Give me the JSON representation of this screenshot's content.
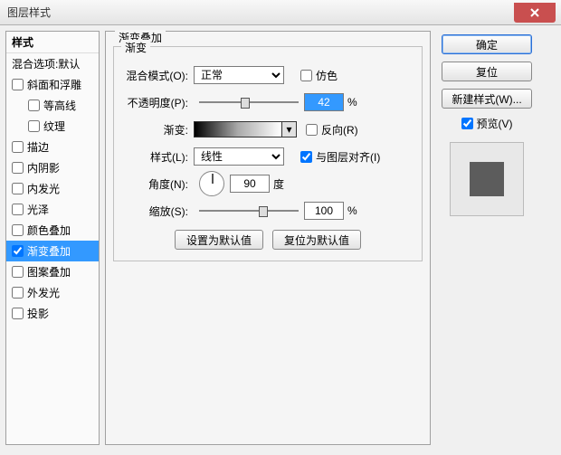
{
  "window": {
    "title": "图层样式"
  },
  "sidebar": {
    "header": "样式",
    "blend": "混合选项:默认",
    "items": [
      {
        "label": "斜面和浮雕",
        "checked": false
      },
      {
        "label": "等高线",
        "checked": false,
        "indent": true
      },
      {
        "label": "纹理",
        "checked": false,
        "indent": true
      },
      {
        "label": "描边",
        "checked": false
      },
      {
        "label": "内阴影",
        "checked": false
      },
      {
        "label": "内发光",
        "checked": false
      },
      {
        "label": "光泽",
        "checked": false
      },
      {
        "label": "颜色叠加",
        "checked": false
      },
      {
        "label": "渐变叠加",
        "checked": true,
        "selected": true
      },
      {
        "label": "图案叠加",
        "checked": false
      },
      {
        "label": "外发光",
        "checked": false
      },
      {
        "label": "投影",
        "checked": false
      }
    ]
  },
  "panel": {
    "title": "渐变叠加",
    "group": "渐变",
    "blendMode": {
      "label": "混合模式(O):",
      "value": "正常"
    },
    "dither": "仿色",
    "opacity": {
      "label": "不透明度(P):",
      "value": "42",
      "unit": "%"
    },
    "gradient": {
      "label": "渐变:"
    },
    "reverse": "反向(R)",
    "style": {
      "label": "样式(L):",
      "value": "线性"
    },
    "align": "与图层对齐(I)",
    "angle": {
      "label": "角度(N):",
      "value": "90",
      "unit": "度"
    },
    "scale": {
      "label": "缩放(S):",
      "value": "100",
      "unit": "%"
    },
    "setDefault": "设置为默认值",
    "resetDefault": "复位为默认值"
  },
  "right": {
    "ok": "确定",
    "cancel": "复位",
    "newStyle": "新建样式(W)...",
    "preview": "预览(V)"
  }
}
